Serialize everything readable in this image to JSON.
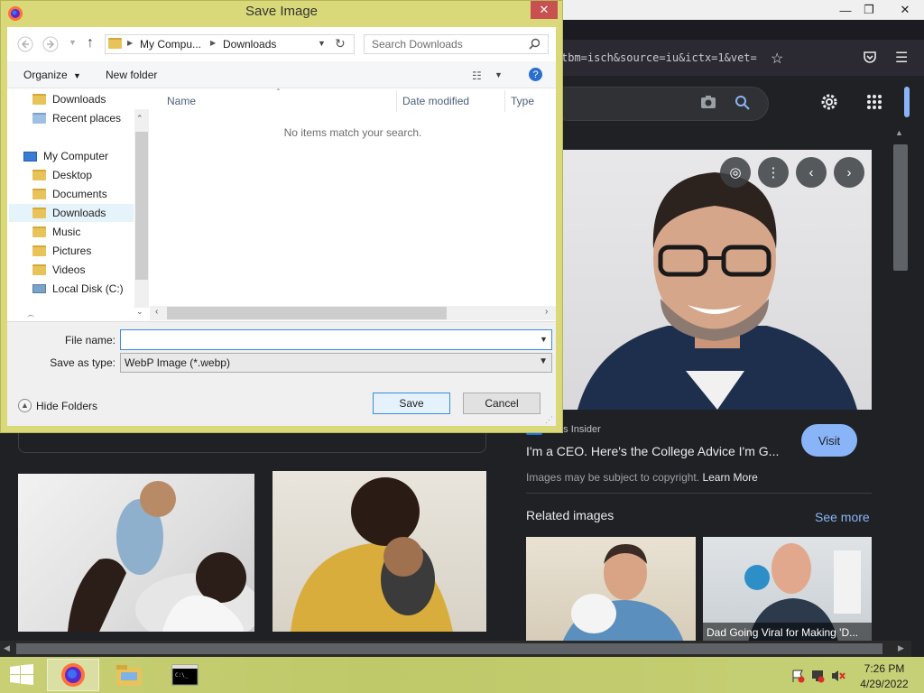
{
  "browser": {
    "url_fragment": "tbm=isch&source=iu&ictx=1&vet=",
    "source": "iness Insider",
    "preview_title": "I'm a CEO. Here's the College Advice I'm G...",
    "visit_label": "Visit",
    "copyright_text": "Images may be subject to copyright.",
    "learn_more_label": "Learn More",
    "related_title": "Related images",
    "see_more_label": "See more",
    "related_caption": "Dad Going Viral for Making 'D...",
    "colors": {
      "link": "#8ab4f8",
      "background": "#202124"
    }
  },
  "dialog": {
    "title": "Save Image",
    "close_label": "✕",
    "address": {
      "segment1": "My Compu...",
      "segment2": "Downloads"
    },
    "search_placeholder": "Search Downloads",
    "toolbar": {
      "organize_label": "Organize",
      "new_folder_label": "New folder"
    },
    "nav_items": [
      {
        "label": "Downloads",
        "icon": "downloads-folder-icon"
      },
      {
        "label": "Recent places",
        "icon": "recent-places-icon"
      },
      {
        "label": "My Computer",
        "icon": "computer-icon"
      },
      {
        "label": "Desktop",
        "icon": "desktop-folder-icon"
      },
      {
        "label": "Documents",
        "icon": "documents-folder-icon"
      },
      {
        "label": "Downloads",
        "icon": "downloads-folder-icon",
        "selected": true
      },
      {
        "label": "Music",
        "icon": "music-folder-icon"
      },
      {
        "label": "Pictures",
        "icon": "pictures-folder-icon"
      },
      {
        "label": "Videos",
        "icon": "videos-folder-icon"
      },
      {
        "label": "Local Disk (C:)",
        "icon": "drive-icon"
      }
    ],
    "columns": {
      "name": "Name",
      "date_modified": "Date modified",
      "type": "Type"
    },
    "empty_message": "No items match your search.",
    "file_name_label": "File name:",
    "file_name_value": "",
    "save_as_type_label": "Save as type:",
    "save_as_type_value": "WebP Image (*.webp)",
    "save_label": "Save",
    "cancel_label": "Cancel",
    "hide_folders_label": "Hide Folders"
  },
  "taskbar": {
    "time": "7:26 PM",
    "date": "4/29/2022"
  }
}
